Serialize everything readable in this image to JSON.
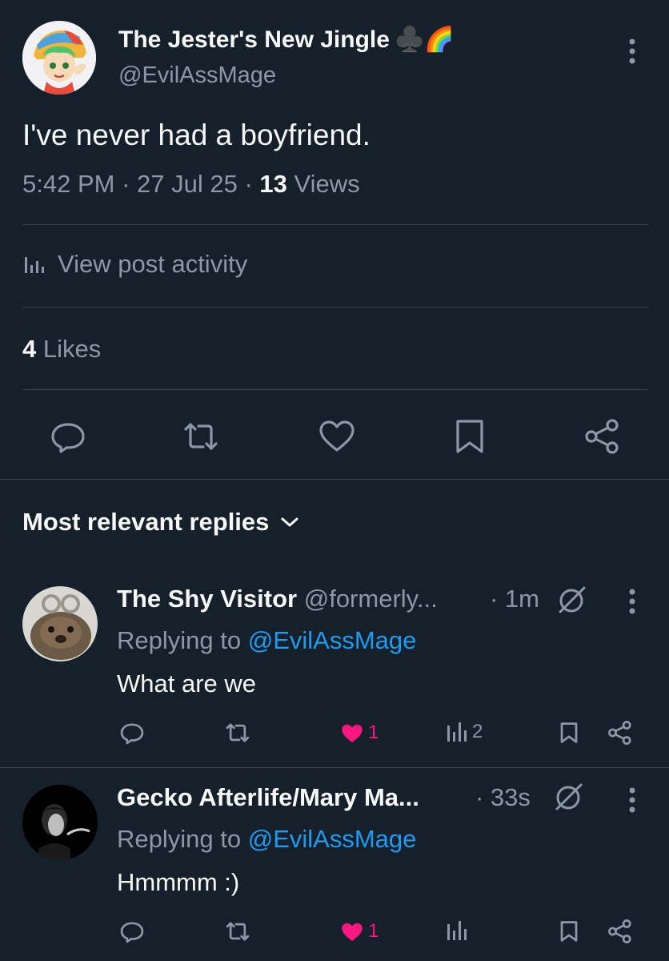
{
  "post": {
    "display_name": "The Jester's New Jingle",
    "name_emojis": "♣️🌈",
    "handle": "@EvilAssMage",
    "text": "I've never had a boyfriend.",
    "time": "5:42 PM",
    "date": "27 Jul 25",
    "views_count": "13",
    "views_label": "Views",
    "activity_label": "View post activity",
    "likes_count": "4",
    "likes_label": "Likes"
  },
  "actions": [
    "reply-icon",
    "repost-icon",
    "like-icon",
    "bookmark-icon",
    "share-icon"
  ],
  "replies_header": {
    "label": "Most relevant replies"
  },
  "replies": [
    {
      "name": "The Shy Visitor",
      "handle": "@formerly...",
      "time": "· 1m",
      "replying_prefix": "Replying to",
      "replying_handle": "@EvilAssMage",
      "text": "What are we",
      "like_count": "1",
      "views_count": "2"
    },
    {
      "name": "Gecko Afterlife/Mary Ma...",
      "handle": "",
      "time": "· 33s",
      "replying_prefix": "Replying to",
      "replying_handle": "@EvilAssMage",
      "text": "Hmmmm :)",
      "like_count": "1",
      "views_count": ""
    }
  ],
  "colors": {
    "background": "#15202b",
    "muted": "#8b98a5",
    "link": "#1d9bf0",
    "like": "#f91880",
    "divider": "#38444d"
  }
}
